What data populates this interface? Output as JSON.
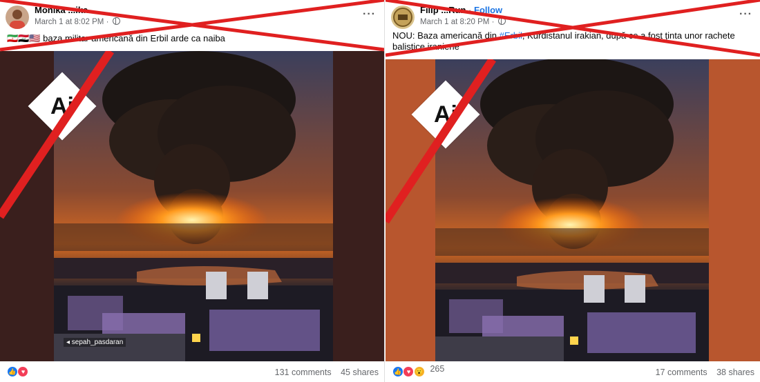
{
  "posts": [
    {
      "author": "Monika",
      "author_suffix": "...ika",
      "timestamp": "March 1 at 8:02 PM",
      "privacy_dot": "·",
      "more": "···",
      "caption": "🇮🇷🇮🇶🇺🇸 baza militar americană din Erbil arde ca naiba",
      "ai_badge": "Ai",
      "watermark": "◂ sepah_pasdaran",
      "comments": "131 comments",
      "shares": "45 shares",
      "reaction_count": "",
      "accent_bg": "#3a1f1d"
    },
    {
      "author": "Filip ...Run",
      "follow_sep": " · ",
      "follow": "Follow",
      "timestamp": "March 1 at 8:20 PM",
      "privacy_dot": "·",
      "more": "···",
      "caption_pre": "NOU: Baza americană din ",
      "hashtag": "#Erbil",
      "caption_post": ", Kurdistanul irakian, după ce a fost ținta unor rachete balistice iraniene",
      "ai_badge": "Ai",
      "comments": "17 comments",
      "shares": "38 shares",
      "reaction_count": "265",
      "accent_bg": "#b8562e"
    }
  ],
  "colors": {
    "x_red": "#e02020",
    "fb_blue": "#1b74e4",
    "meta_gray": "#65676b"
  }
}
